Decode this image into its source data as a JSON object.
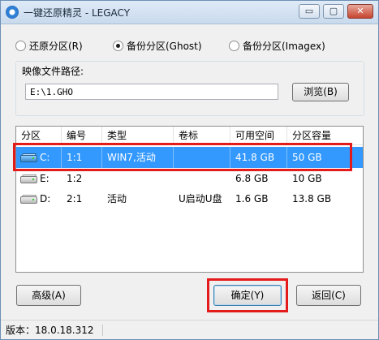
{
  "window": {
    "title": "一键还原精灵 - LEGACY",
    "controls": {
      "minimize": "▭",
      "maximize": "▢",
      "close": "✕"
    }
  },
  "modes": [
    {
      "label": "还原分区(R)",
      "checked": false
    },
    {
      "label": "备份分区(Ghost)",
      "checked": true
    },
    {
      "label": "备份分区(Imagex)",
      "checked": false
    }
  ],
  "image_path": {
    "label": "映像文件路径:",
    "value": "E:\\1.GHO",
    "browse_label": "浏览(B)"
  },
  "table": {
    "columns": [
      "分区",
      "编号",
      "类型",
      "卷标",
      "可用空间",
      "分区容量"
    ],
    "rows": [
      {
        "partition": "C:",
        "number": "1:1",
        "type": "WIN7,活动",
        "label": "",
        "free": "41.8 GB",
        "size": "50 GB",
        "selected": true,
        "icon": "system-drive-icon"
      },
      {
        "partition": "E:",
        "number": "1:2",
        "type": "",
        "label": "",
        "free": "6.8 GB",
        "size": "10 GB",
        "selected": false,
        "icon": "drive-icon"
      },
      {
        "partition": "D:",
        "number": "2:1",
        "type": "活动",
        "label": "U启动U盘",
        "free": "1.6 GB",
        "size": "13.8 GB",
        "selected": false,
        "icon": "drive-icon"
      }
    ]
  },
  "buttons": {
    "advanced": "高级(A)",
    "ok": "确定(Y)",
    "back": "返回(C)"
  },
  "status": {
    "version": "版本：18.0.18.312"
  },
  "colors": {
    "selection": "#3399ff",
    "highlight": "#e41b1b"
  }
}
